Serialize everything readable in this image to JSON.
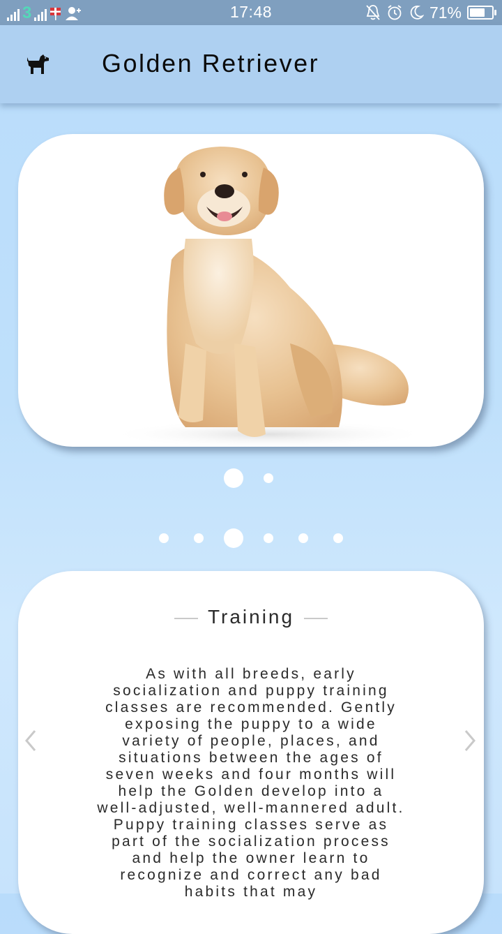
{
  "status_bar": {
    "time": "17:48",
    "carrier": "3",
    "battery_percent": "71%",
    "battery_level": 0.71,
    "icons": [
      "signal-icon",
      "network-3-icon",
      "flag-icon",
      "person-add-icon",
      "mute-icon",
      "alarm-icon",
      "moon-icon",
      "battery-icon"
    ]
  },
  "app_bar": {
    "title": "Golden Retriever",
    "icon": "dog-icon"
  },
  "gallery": {
    "image": "golden-retriever-photo",
    "page_count": 2,
    "active_page": 0
  },
  "section_pager": {
    "page_count": 6,
    "active_page": 2
  },
  "info_card": {
    "heading": "Training",
    "body": "As with all breeds, early socialization and puppy training classes are recommended. Gently exposing the puppy to a wide variety of people, places, and situations between the ages of seven weeks and four months will help the Golden develop into a well-adjusted, well-mannered adult. Puppy training classes serve as part of the socialization process and help the owner learn to recognize and correct any bad habits that may",
    "prev_icon": "chevron-left-icon",
    "next_icon": "chevron-right-icon"
  },
  "colors": {
    "status_bar": "#7f9fbf",
    "app_bar": "#aed0f1",
    "background": "#bfe0fb",
    "card": "#ffffff"
  }
}
